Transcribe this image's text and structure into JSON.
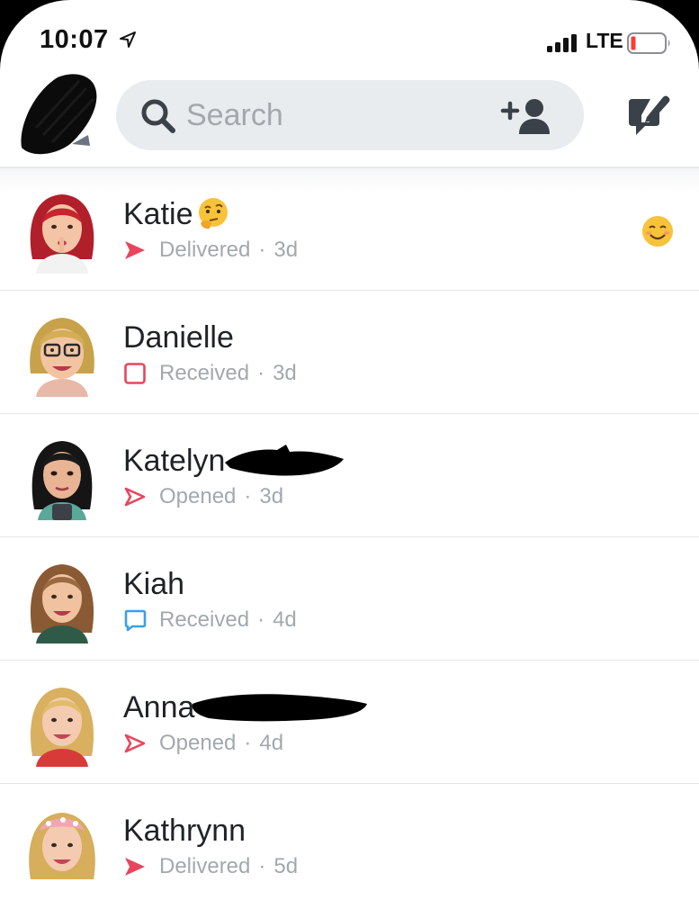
{
  "status_bar": {
    "time": "10:07",
    "network": "LTE",
    "icons": [
      "location-arrow-icon",
      "cellular-signal-icon",
      "battery-low-icon"
    ],
    "battery_color": "#ff3b30"
  },
  "header": {
    "search_placeholder": "Search",
    "icons": [
      "search-icon",
      "add-friend-icon",
      "new-chat-icon"
    ]
  },
  "colors": {
    "snap_red": "#e8455c",
    "chat_blue": "#3aa0e8",
    "search_bg": "#e9ecee",
    "secondary_text": "#a3a8ad"
  },
  "chats": [
    {
      "name": "Katie",
      "name_emoji": "thinking-face-emoji",
      "status": "Delivered",
      "status_icon": "filled-red-arrow-icon",
      "time": "3d",
      "row_emoji": "smiling-face-emoji"
    },
    {
      "name": "Danielle",
      "status": "Received",
      "status_icon": "outline-red-square-icon",
      "time": "3d"
    },
    {
      "name": "Katelyn",
      "status": "Opened",
      "status_icon": "outline-red-arrow-icon",
      "time": "3d"
    },
    {
      "name": "Kiah",
      "status": "Received",
      "status_icon": "outline-blue-chat-icon",
      "time": "4d"
    },
    {
      "name": "Anna",
      "status": "Opened",
      "status_icon": "outline-red-arrow-icon",
      "time": "4d"
    },
    {
      "name": "Kathrynn",
      "status": "Delivered",
      "status_icon": "filled-red-arrow-icon",
      "time": "5d"
    }
  ],
  "separator": "·"
}
